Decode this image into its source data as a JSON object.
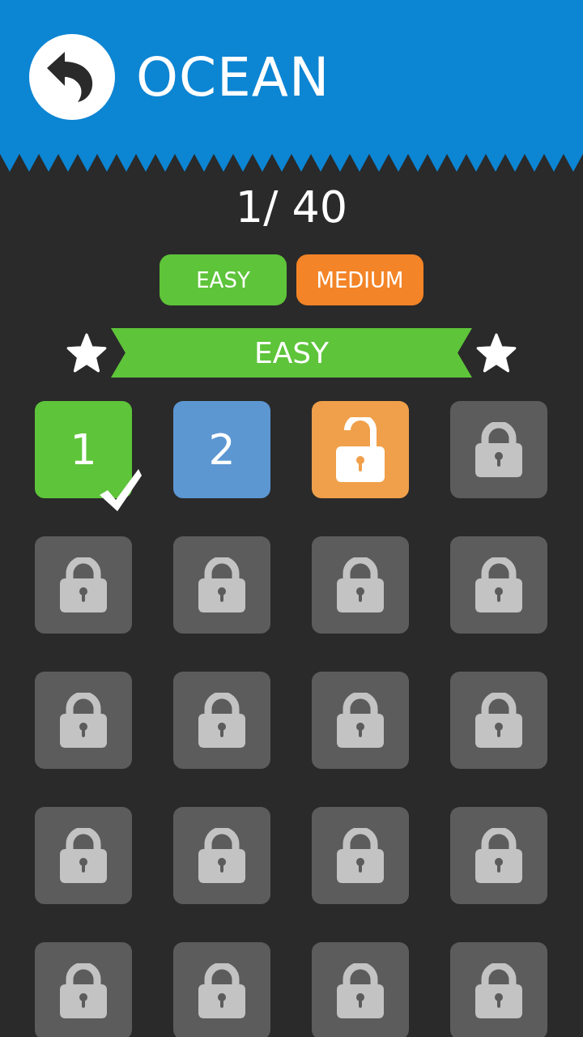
{
  "header": {
    "title": "OCEAN"
  },
  "progress": "1/ 40",
  "difficulty_tabs": [
    {
      "label": "EASY",
      "color": "#5ec43a"
    },
    {
      "label": "MEDIUM",
      "color": "#f38427"
    }
  ],
  "section_banner": {
    "label": "EASY"
  },
  "levels": [
    {
      "kind": "completed",
      "label": "1"
    },
    {
      "kind": "available",
      "label": "2"
    },
    {
      "kind": "unlocked"
    },
    {
      "kind": "locked"
    },
    {
      "kind": "locked"
    },
    {
      "kind": "locked"
    },
    {
      "kind": "locked"
    },
    {
      "kind": "locked"
    },
    {
      "kind": "locked"
    },
    {
      "kind": "locked"
    },
    {
      "kind": "locked"
    },
    {
      "kind": "locked"
    },
    {
      "kind": "locked"
    },
    {
      "kind": "locked"
    },
    {
      "kind": "locked"
    },
    {
      "kind": "locked"
    },
    {
      "kind": "locked"
    },
    {
      "kind": "locked"
    },
    {
      "kind": "locked"
    },
    {
      "kind": "locked"
    }
  ]
}
